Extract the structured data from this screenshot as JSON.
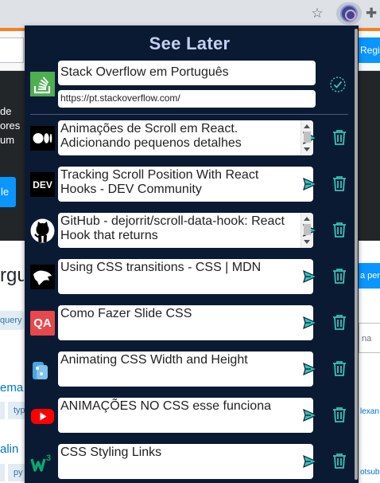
{
  "popup": {
    "title": "See Later",
    "add_form": {
      "title_value": "Stack Overflow em Português",
      "url_value": "https://pt.stackoverflow.com/",
      "favicon": "stackoverflow-icon"
    },
    "items": [
      {
        "title": "Animações de Scroll em React. Adicionando pequenos detalhes",
        "favicon": "medium-icon"
      },
      {
        "title": "Tracking Scroll Position With React Hooks - DEV Community",
        "favicon": "dev-icon"
      },
      {
        "title": "GitHub - dejorrit/scroll-data-hook: React Hook that returns",
        "favicon": "github-icon"
      },
      {
        "title": "Using CSS transitions - CSS | MDN",
        "favicon": "mdn-icon"
      },
      {
        "title": "Como Fazer Slide CSS",
        "favicon": "qa-icon"
      },
      {
        "title": "Animating CSS Width and Height",
        "favicon": "css-icon"
      },
      {
        "title": "ANIMAÇÕES NO CSS esse funciona",
        "favicon": "youtube-icon"
      },
      {
        "title": "CSS Styling Links",
        "favicon": "w3schools-icon"
      }
    ],
    "favicon_texts": {
      "dev": "DEV",
      "qa": "QA"
    }
  },
  "background": {
    "register_label": "Regi",
    "hero_text": "de\nores\num",
    "hero_button": "le",
    "page_heading": "rgu",
    "ask_button": "a per",
    "tag_query": "query",
    "search_placeholder": "na",
    "question_1": "ema",
    "tag_typ": "typ",
    "question_2": "alin",
    "tag_py": "py",
    "user_1": "lexan",
    "user_2": "otsub"
  },
  "colors": {
    "popup_bg": "#0b1a33",
    "title_color": "#c4cff2",
    "accent": "#34c4b8"
  }
}
